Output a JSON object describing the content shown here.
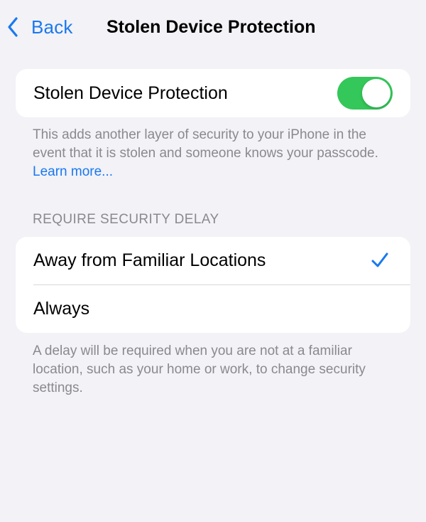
{
  "nav": {
    "back_label": "Back",
    "title": "Stolen Device Protection"
  },
  "protection": {
    "label": "Stolen Device Protection",
    "enabled": true,
    "footer_text": "This adds another layer of security to your iPhone in the event that it is stolen and someone knows your passcode.",
    "learn_more": "Learn more..."
  },
  "security_delay": {
    "header": "REQUIRE SECURITY DELAY",
    "options": [
      {
        "label": "Away from Familiar Locations",
        "selected": true
      },
      {
        "label": "Always",
        "selected": false
      }
    ],
    "footer_text": "A delay will be required when you are not at a familiar location, such as your home or work, to change security settings."
  },
  "colors": {
    "accent": "#1a78f0",
    "toggle_on": "#34c759",
    "background": "#f2f2f7",
    "secondary_text": "#8a8a8e"
  },
  "icons": {
    "back": "chevron-left-icon",
    "selected": "checkmark-icon"
  }
}
